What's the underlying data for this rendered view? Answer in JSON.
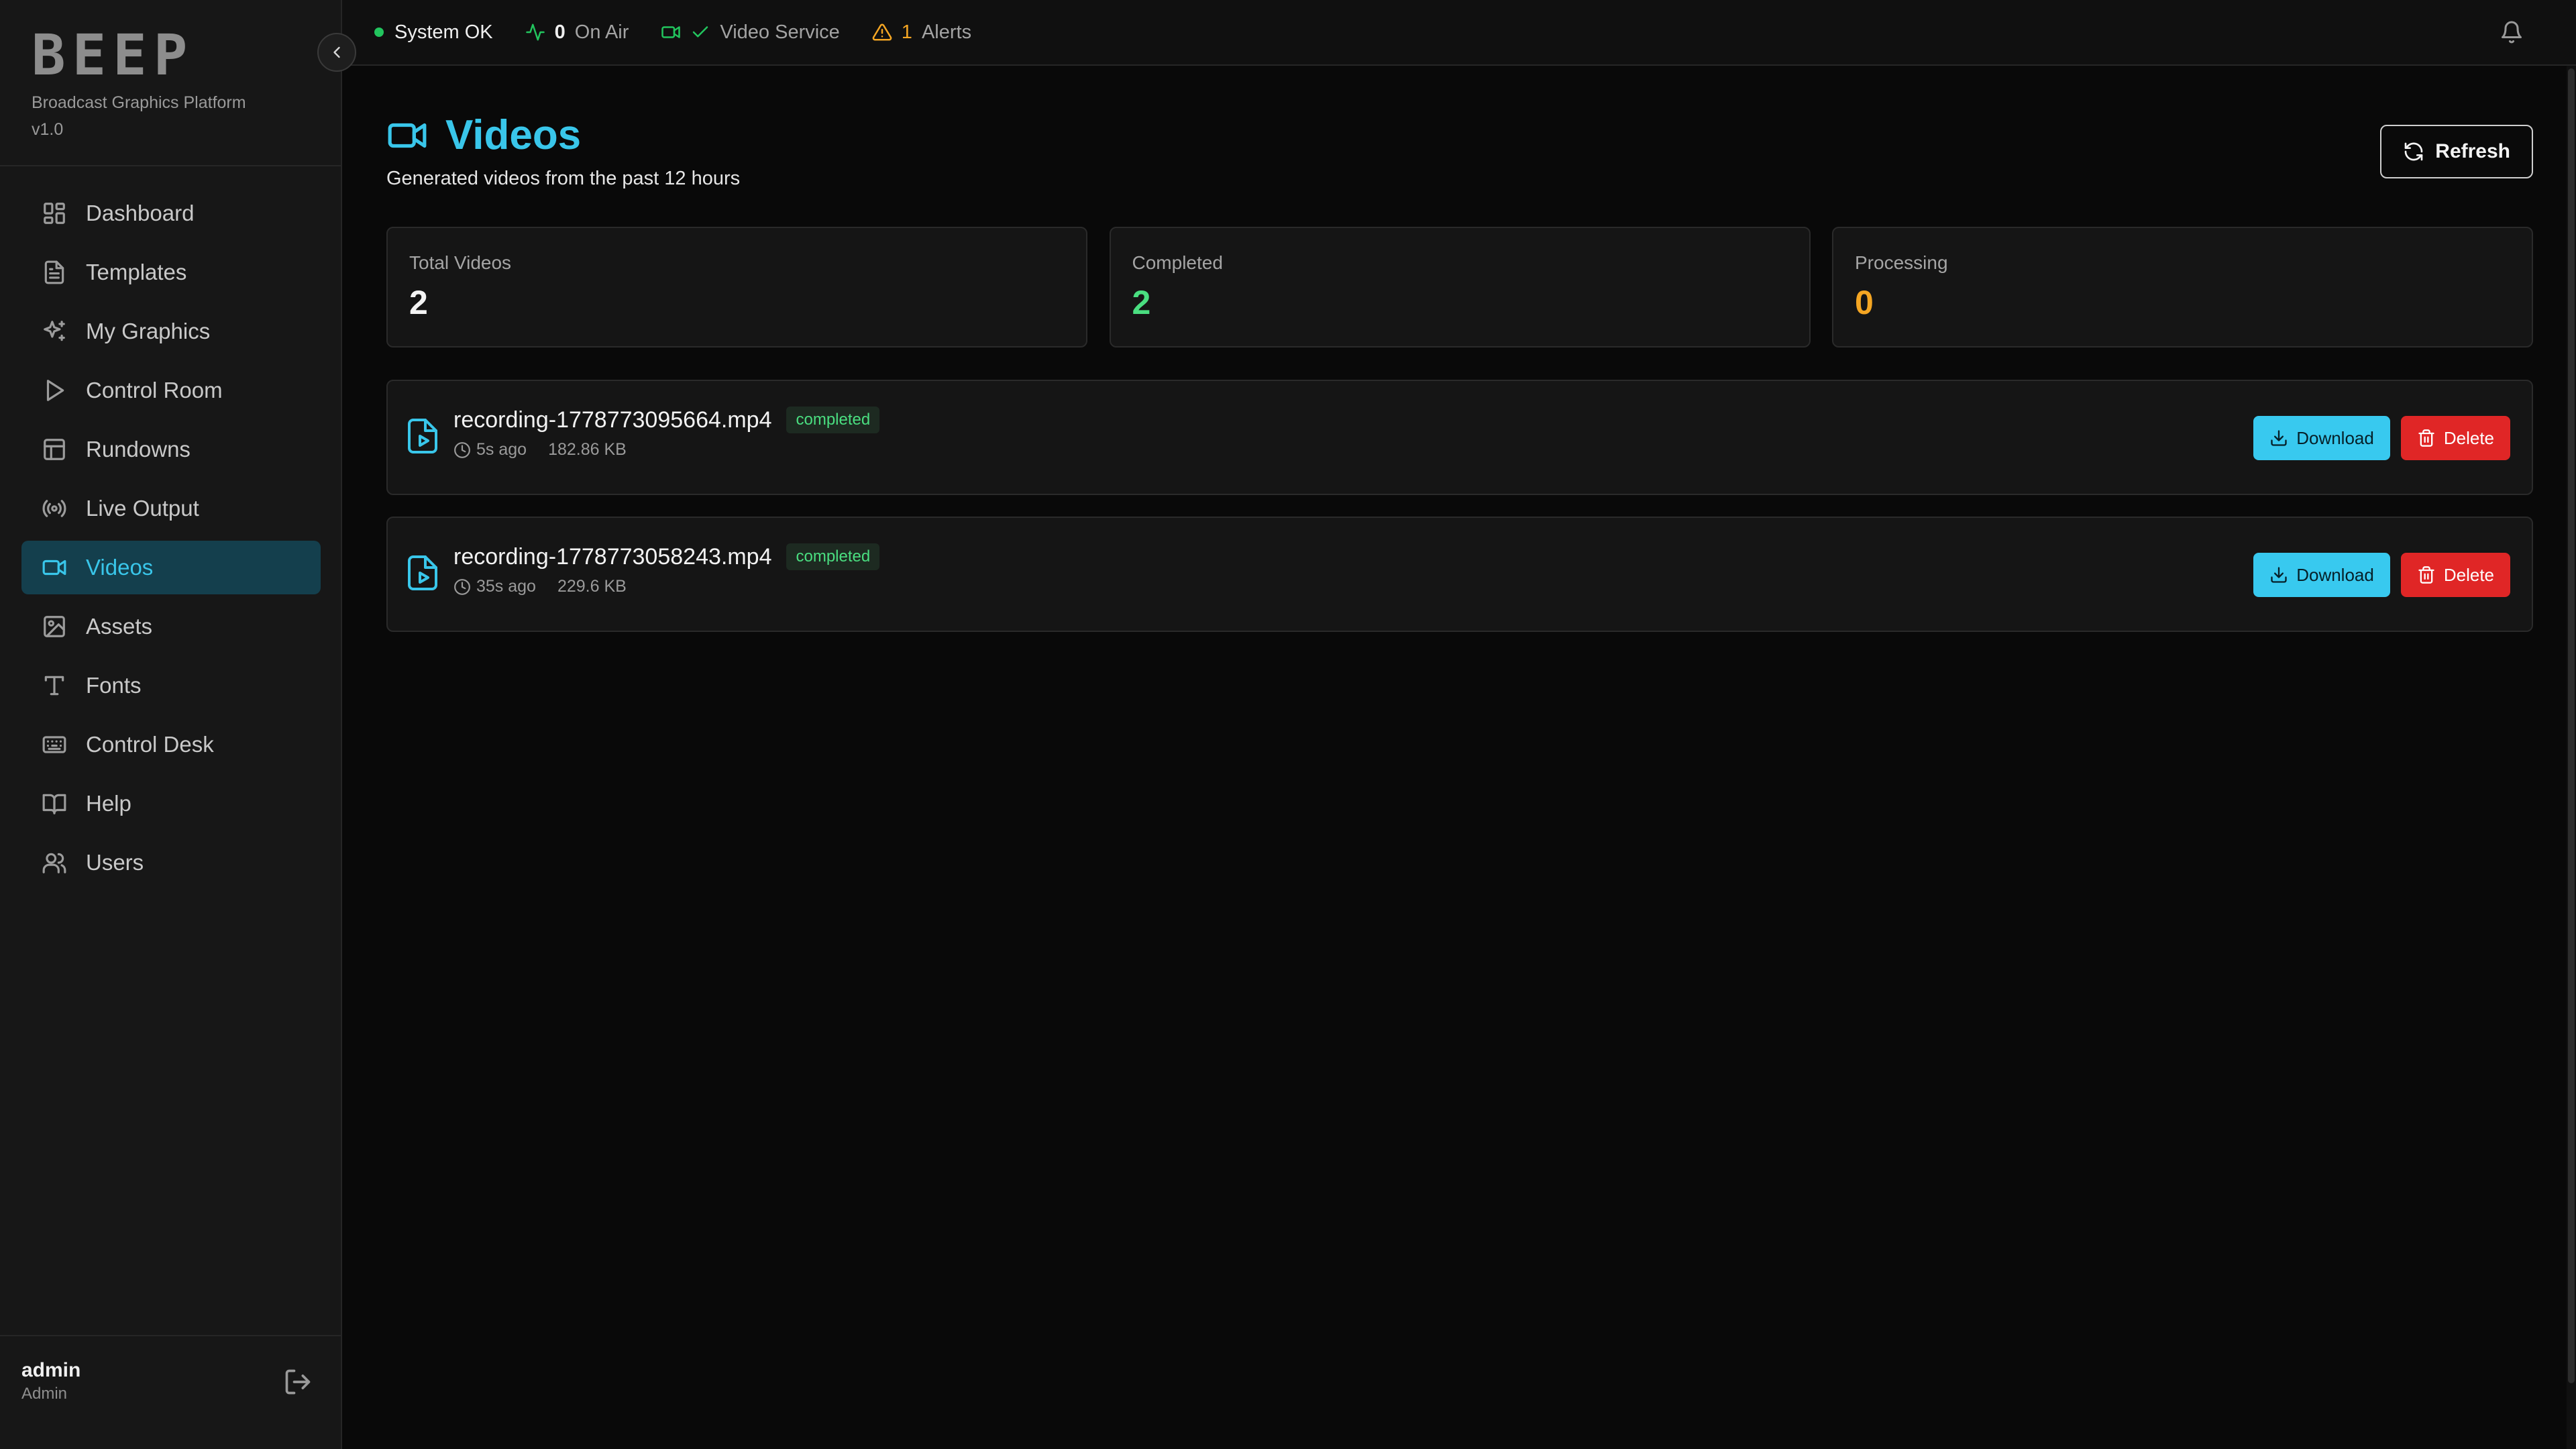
{
  "brand": {
    "logo": "BEEP",
    "subtitle": "Broadcast Graphics Platform",
    "version": "v1.0"
  },
  "sidebar": {
    "items": [
      {
        "label": "Dashboard",
        "icon": "dashboard-icon"
      },
      {
        "label": "Templates",
        "icon": "template-icon"
      },
      {
        "label": "My Graphics",
        "icon": "sparkles-icon"
      },
      {
        "label": "Control Room",
        "icon": "play-icon"
      },
      {
        "label": "Rundowns",
        "icon": "table-icon"
      },
      {
        "label": "Live Output",
        "icon": "broadcast-icon"
      },
      {
        "label": "Videos",
        "icon": "video-icon",
        "active": true
      },
      {
        "label": "Assets",
        "icon": "image-icon"
      },
      {
        "label": "Fonts",
        "icon": "type-icon"
      },
      {
        "label": "Control Desk",
        "icon": "keyboard-icon"
      },
      {
        "label": "Help",
        "icon": "book-icon"
      },
      {
        "label": "Users",
        "icon": "users-icon"
      }
    ]
  },
  "user": {
    "name": "admin",
    "role": "Admin"
  },
  "topbar": {
    "system_status": "System OK",
    "on_air_count": "0",
    "on_air_label": "On Air",
    "video_service_label": "Video Service",
    "alerts_count": "1",
    "alerts_label": "Alerts"
  },
  "page": {
    "title": "Videos",
    "subtitle": "Generated videos from the past 12 hours",
    "refresh_label": "Refresh"
  },
  "stats": [
    {
      "label": "Total Videos",
      "value": "2",
      "color": "#f4f4f4"
    },
    {
      "label": "Completed",
      "value": "2",
      "color": "#4ade80"
    },
    {
      "label": "Processing",
      "value": "0",
      "color": "#f5a623"
    }
  ],
  "videos": [
    {
      "name": "recording-1778773095664.mp4",
      "status": "completed",
      "age": "5s ago",
      "size": "182.86 KB"
    },
    {
      "name": "recording-1778773058243.mp4",
      "status": "completed",
      "age": "35s ago",
      "size": "229.6 KB"
    }
  ],
  "actions": {
    "download_label": "Download",
    "delete_label": "Delete"
  },
  "colors": {
    "accent": "#39c6ea",
    "success": "#22c55e",
    "warning": "#f5a623",
    "danger": "#e02626"
  }
}
